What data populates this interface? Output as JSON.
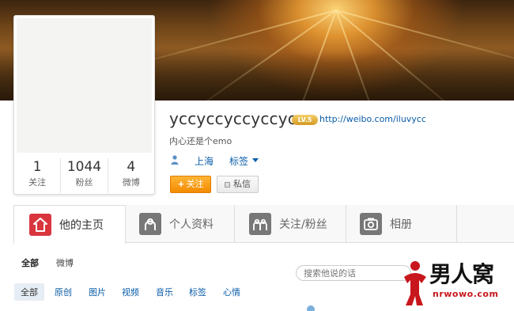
{
  "profile": {
    "nickname": "yccyccyccyccycc",
    "level_badge": "LV.5",
    "url": "http://weibo.com/iluvycc",
    "description": "内心还是个emo",
    "location": "上海",
    "tags_label": "标签",
    "follow_button": "关注",
    "follow_plus": "+",
    "message_button": "私信"
  },
  "stats": [
    {
      "value": "1",
      "label": "关注"
    },
    {
      "value": "1044",
      "label": "粉丝"
    },
    {
      "value": "4",
      "label": "微博"
    }
  ],
  "tabs": [
    {
      "label": "他的主页",
      "icon": "home-icon",
      "active": true
    },
    {
      "label": "个人资料",
      "icon": "profile-icon"
    },
    {
      "label": "关注/粉丝",
      "icon": "users-icon"
    },
    {
      "label": "相册",
      "icon": "camera-icon"
    }
  ],
  "feed_tabs": [
    {
      "label": "全部",
      "active": true
    },
    {
      "label": "微博"
    }
  ],
  "search": {
    "placeholder": "搜索他说的话"
  },
  "filters": [
    "全部",
    "原创",
    "图片",
    "视频",
    "音乐",
    "标签",
    "心情"
  ],
  "watermark": {
    "brand": "男人窝",
    "url": "nrwowo.com"
  },
  "colors": {
    "accent_orange": "#f28a00",
    "link_blue": "#0a5ca8",
    "tab_icon_active": "#d9363e"
  }
}
